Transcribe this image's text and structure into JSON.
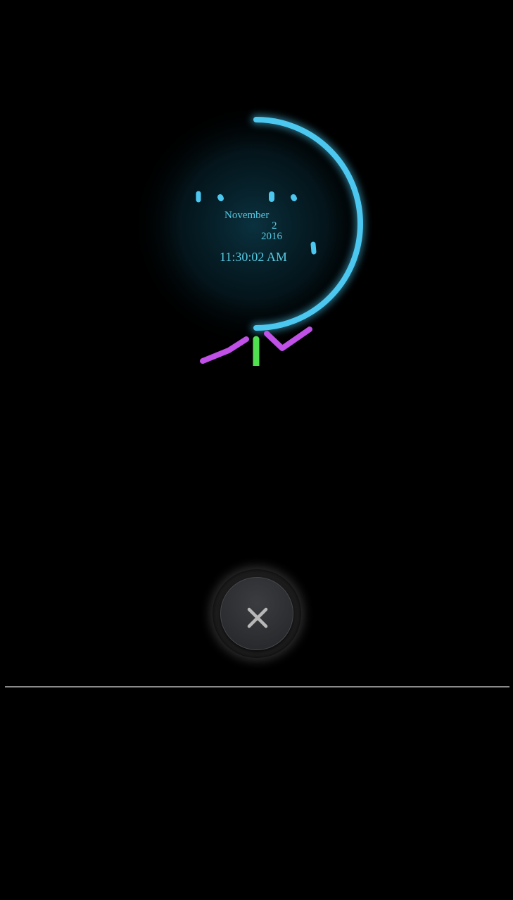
{
  "clock": {
    "month": "November",
    "day": "2",
    "year": "2016",
    "time": "11:30:02 AM",
    "arc_color": "#4cc8f0",
    "hand_hour_color": "#c050e8",
    "hand_second_color": "#50e050"
  },
  "controls": {
    "close_icon": "close-icon"
  }
}
